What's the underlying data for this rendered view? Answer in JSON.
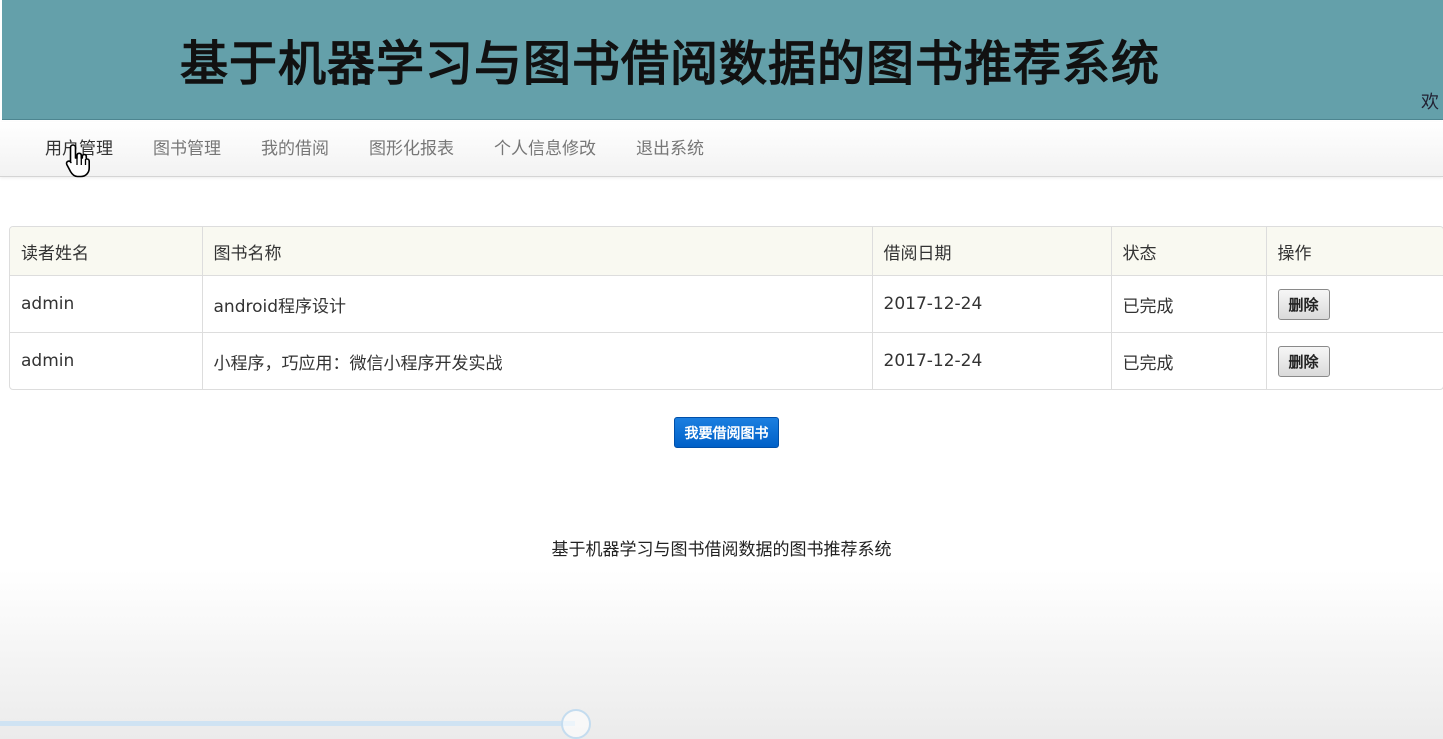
{
  "banner": {
    "title": "基于机器学习与图书借阅数据的图书推荐系统",
    "welcome": "欢"
  },
  "nav": {
    "items": [
      {
        "label": "用户管理"
      },
      {
        "label": "图书管理"
      },
      {
        "label": "我的借阅"
      },
      {
        "label": "图形化报表"
      },
      {
        "label": "个人信息修改"
      },
      {
        "label": "退出系统"
      }
    ],
    "active_index": 0
  },
  "table": {
    "headers": [
      "读者姓名",
      "图书名称",
      "借阅日期",
      "状态",
      "操作"
    ],
    "rows": [
      {
        "reader": "admin",
        "book": "android程序设计",
        "date": "2017-12-24",
        "status": "已完成",
        "action": "删除"
      },
      {
        "reader": "admin",
        "book": "小程序，巧应用：微信小程序开发实战",
        "date": "2017-12-24",
        "status": "已完成",
        "action": "删除"
      }
    ]
  },
  "borrow_button": {
    "label": "我要借阅图书"
  },
  "footer": {
    "text": "基于机器学习与图书借阅数据的图书推荐系统"
  },
  "video_progress": {
    "fraction": 0.4
  },
  "colors": {
    "banner": "#64a0aa",
    "primary_button": "#0a6fd6"
  }
}
